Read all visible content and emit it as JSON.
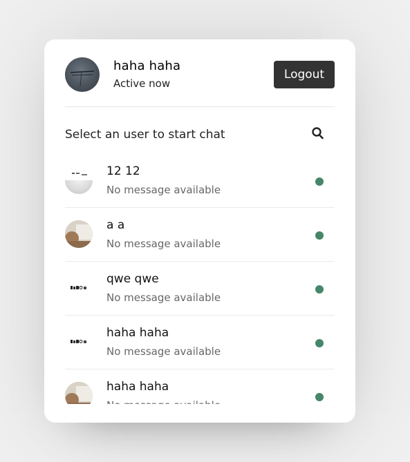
{
  "header": {
    "user_name": "haha haha",
    "status": "Active now",
    "logout_label": "Logout"
  },
  "search": {
    "prompt": "Select an user to start chat",
    "icon": "search-icon"
  },
  "users": [
    {
      "name": "12 12",
      "message": "No message available",
      "online": true,
      "avatar": "gray"
    },
    {
      "name": "a a",
      "message": "No message available",
      "online": true,
      "avatar": "photo"
    },
    {
      "name": "qwe qwe",
      "message": "No message available",
      "online": true,
      "avatar": "white"
    },
    {
      "name": "haha haha",
      "message": "No message available",
      "online": true,
      "avatar": "white"
    },
    {
      "name": "haha haha",
      "message": "No message available",
      "online": true,
      "avatar": "photo"
    }
  ],
  "colors": {
    "online_dot": "#468669",
    "logout_bg": "#333333",
    "background": "#f0f0f0"
  }
}
